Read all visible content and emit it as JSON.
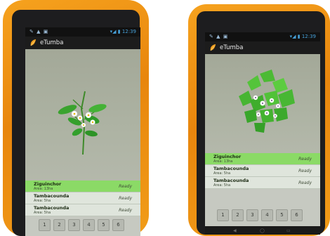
{
  "colors": {
    "case": "#f19c18",
    "accent_green": "#8bda66",
    "screen": "#a9ae9c"
  },
  "left_tablet": {
    "status": {
      "left_icons": "✎ ▲ ▣",
      "right": "▾◢ ▮ 12:39"
    },
    "app": {
      "title": "eTumba",
      "logo": "leaf-logo"
    },
    "list": [
      {
        "name": "Ziguinchor",
        "area": "Area: 13ha",
        "status": "Ready",
        "selected": true
      },
      {
        "name": "Tambacounda",
        "area": "Area: 5ha",
        "status": "Ready",
        "selected": false
      },
      {
        "name": "Tambacounda",
        "area": "Area: 5ha",
        "status": "Ready",
        "selected": false
      }
    ],
    "pages": [
      "1",
      "2",
      "3",
      "4",
      "5",
      "6"
    ]
  },
  "right_tablet": {
    "status": {
      "left_icons": "✎ ▲ ▣",
      "right": "▾◢ ▮ 12:39"
    },
    "app": {
      "title": "eTumba",
      "logo": "leaf-logo"
    },
    "list": [
      {
        "name": "Ziguinchor",
        "area": "Area: 13ha",
        "status": "Ready",
        "selected": true
      },
      {
        "name": "Tambacounda",
        "area": "Area: 5ha",
        "status": "Ready",
        "selected": false
      },
      {
        "name": "Tambacounda",
        "area": "Area: 5ha",
        "status": "Ready",
        "selected": false
      }
    ],
    "pages": [
      "1",
      "2",
      "3",
      "4",
      "5",
      "6"
    ],
    "nav_icons": [
      "back-icon",
      "home-icon",
      "recents-icon"
    ]
  }
}
